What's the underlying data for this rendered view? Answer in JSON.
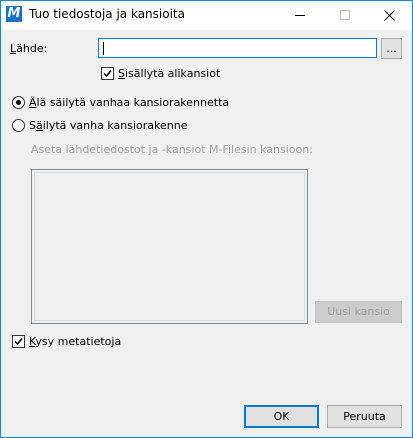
{
  "window": {
    "title": "Tuo tiedostoja ja kansioita",
    "app_icon_letter": "M",
    "title_bar_buttons": [
      "minimize-icon",
      "maximize-icon",
      "close-icon"
    ]
  },
  "source": {
    "label_prefix": "",
    "label_u": "L",
    "label_rest": "ähde:",
    "value": "",
    "browse_label": "..."
  },
  "include_subfolders": {
    "checked": true,
    "label_u": "S",
    "label_rest": "isällytä alikansiot"
  },
  "structure": {
    "option_flat": {
      "checked": true,
      "label_u": "Ä",
      "label_rest": "lä säilytä vanhaa kansiorakennetta"
    },
    "option_keep": {
      "checked": false,
      "label_pre": "S",
      "label_u": "ä",
      "label_rest": "ilytä vanha kansiorakenne"
    },
    "target_label": "Aseta lähdetiedostot ja -kansiot M-Filesin kansioon:",
    "new_folder_label": "Uusi kansio"
  },
  "ask_metadata": {
    "checked": true,
    "label_u": "K",
    "label_rest": "ysy metatietoja"
  },
  "buttons": {
    "ok": "OK",
    "cancel": "Peruuta"
  }
}
